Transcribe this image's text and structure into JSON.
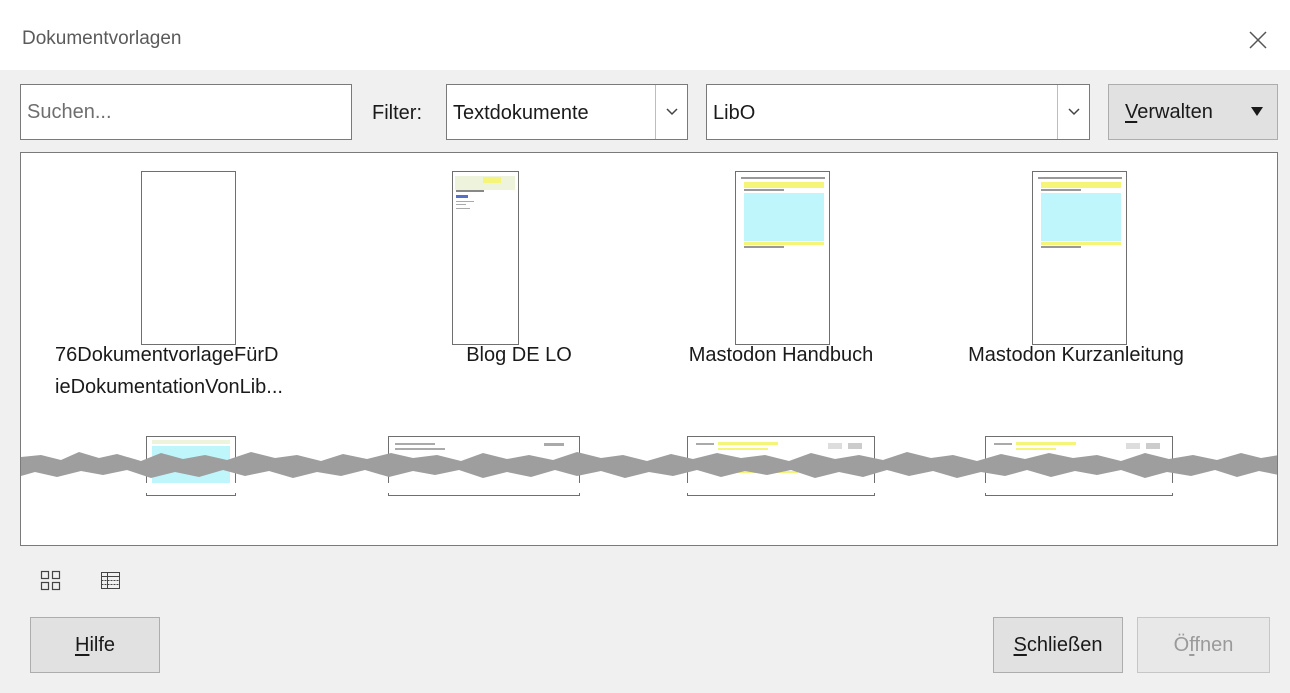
{
  "window": {
    "title": "Dokumentvorlagen"
  },
  "toolbar": {
    "search_placeholder": "Suchen...",
    "filter_label": "Filter:",
    "filter_value": "Textdokumente",
    "category_value": "LibO",
    "manage_label_accel": "V",
    "manage_label_rest": "erwalten"
  },
  "templates": [
    {
      "name": "76DokumentvorlageFürD\nieDokumentationVonLib..."
    },
    {
      "name": "Blog DE LO"
    },
    {
      "name": "Mastodon Handbuch"
    },
    {
      "name": "Mastodon Kurzanleitung"
    }
  ],
  "footer": {
    "help_accel": "H",
    "help_rest": "ilfe",
    "close_accel": "S",
    "close_rest": "chließen",
    "open_pre": "Ö",
    "open_accel": "f",
    "open_rest": "fnen"
  },
  "icons": [
    "close-icon",
    "chevron-down-icon",
    "thumbnail-view-icon",
    "list-view-icon",
    "dropdown-caret-icon"
  ],
  "colors": {
    "thumb_fill": "#bff6fb",
    "highlight": "#f5f57a",
    "tear": "#9e9e9e"
  }
}
